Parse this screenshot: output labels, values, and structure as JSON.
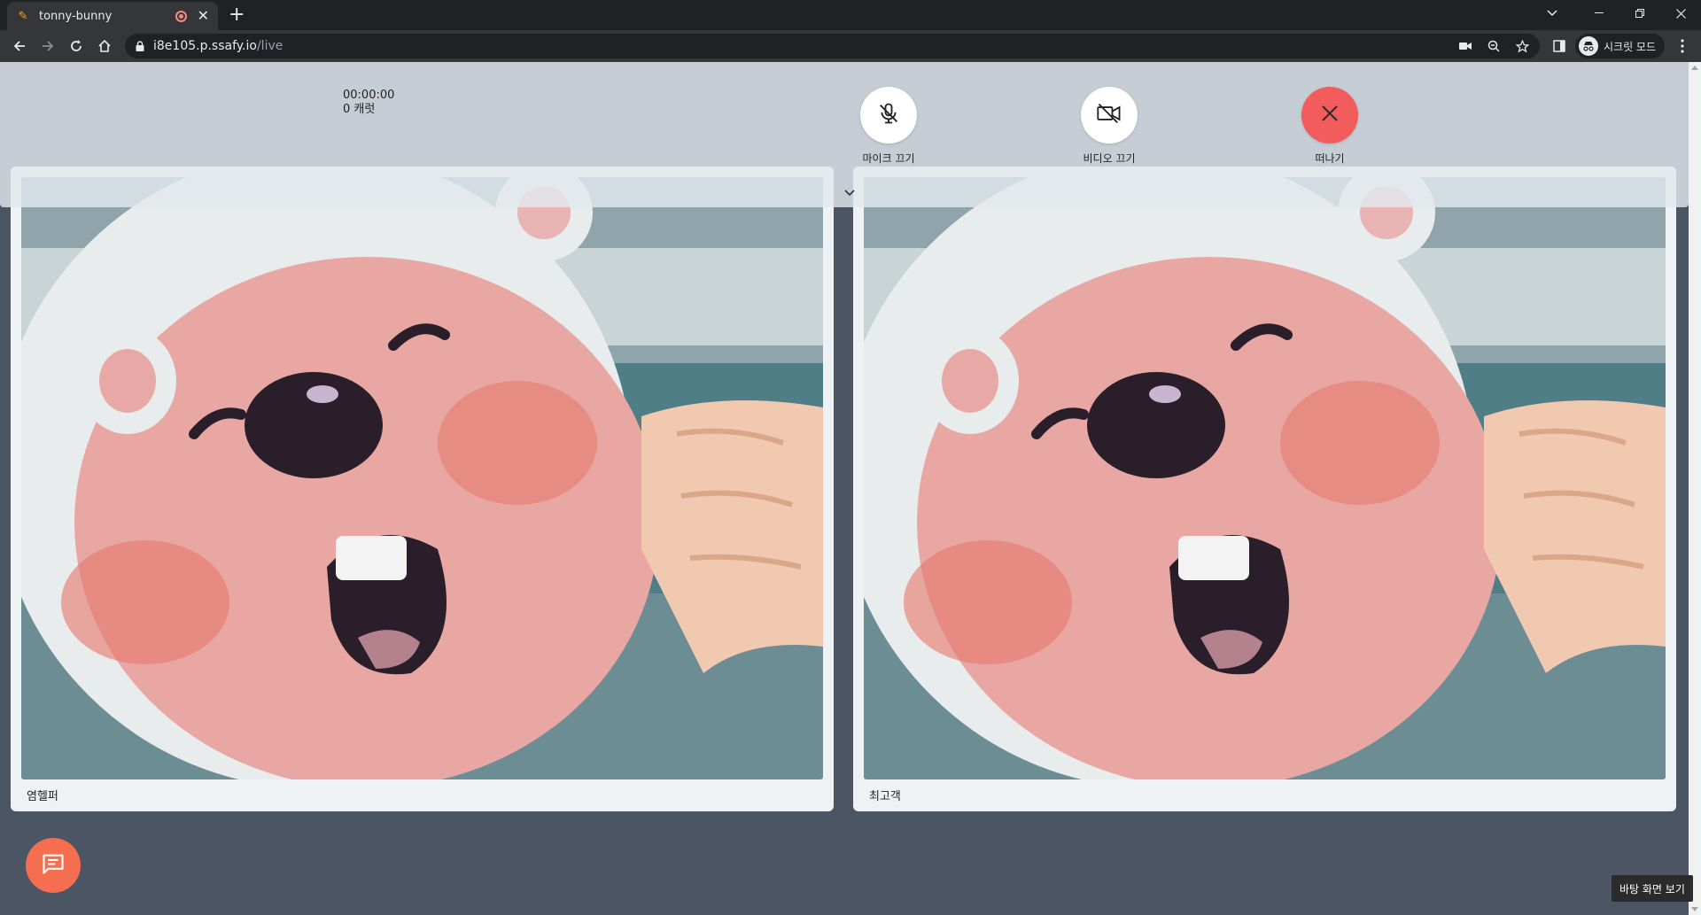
{
  "browser": {
    "tab": {
      "title": "tonny-bunny",
      "favicon": "pencil-icon"
    },
    "url_host": "i8e105.p.ssafy.io",
    "url_path": "/live",
    "profile_label": "시크릿 모드"
  },
  "session": {
    "timer": "00:00:00",
    "carrots": "0 캐럿"
  },
  "controls": {
    "mic_label": "마이크 끄기",
    "video_label": "비디오 끄기",
    "leave_label": "떠나기"
  },
  "participants": [
    {
      "name": "염헬퍼"
    },
    {
      "name": "최고객"
    }
  ],
  "colors": {
    "leave_button": "#f25c5c",
    "chat_button": "#f56e50",
    "page_background": "#4b5563",
    "card_background": "#eef2f5"
  },
  "tooltip": "바탕 화면 보기"
}
